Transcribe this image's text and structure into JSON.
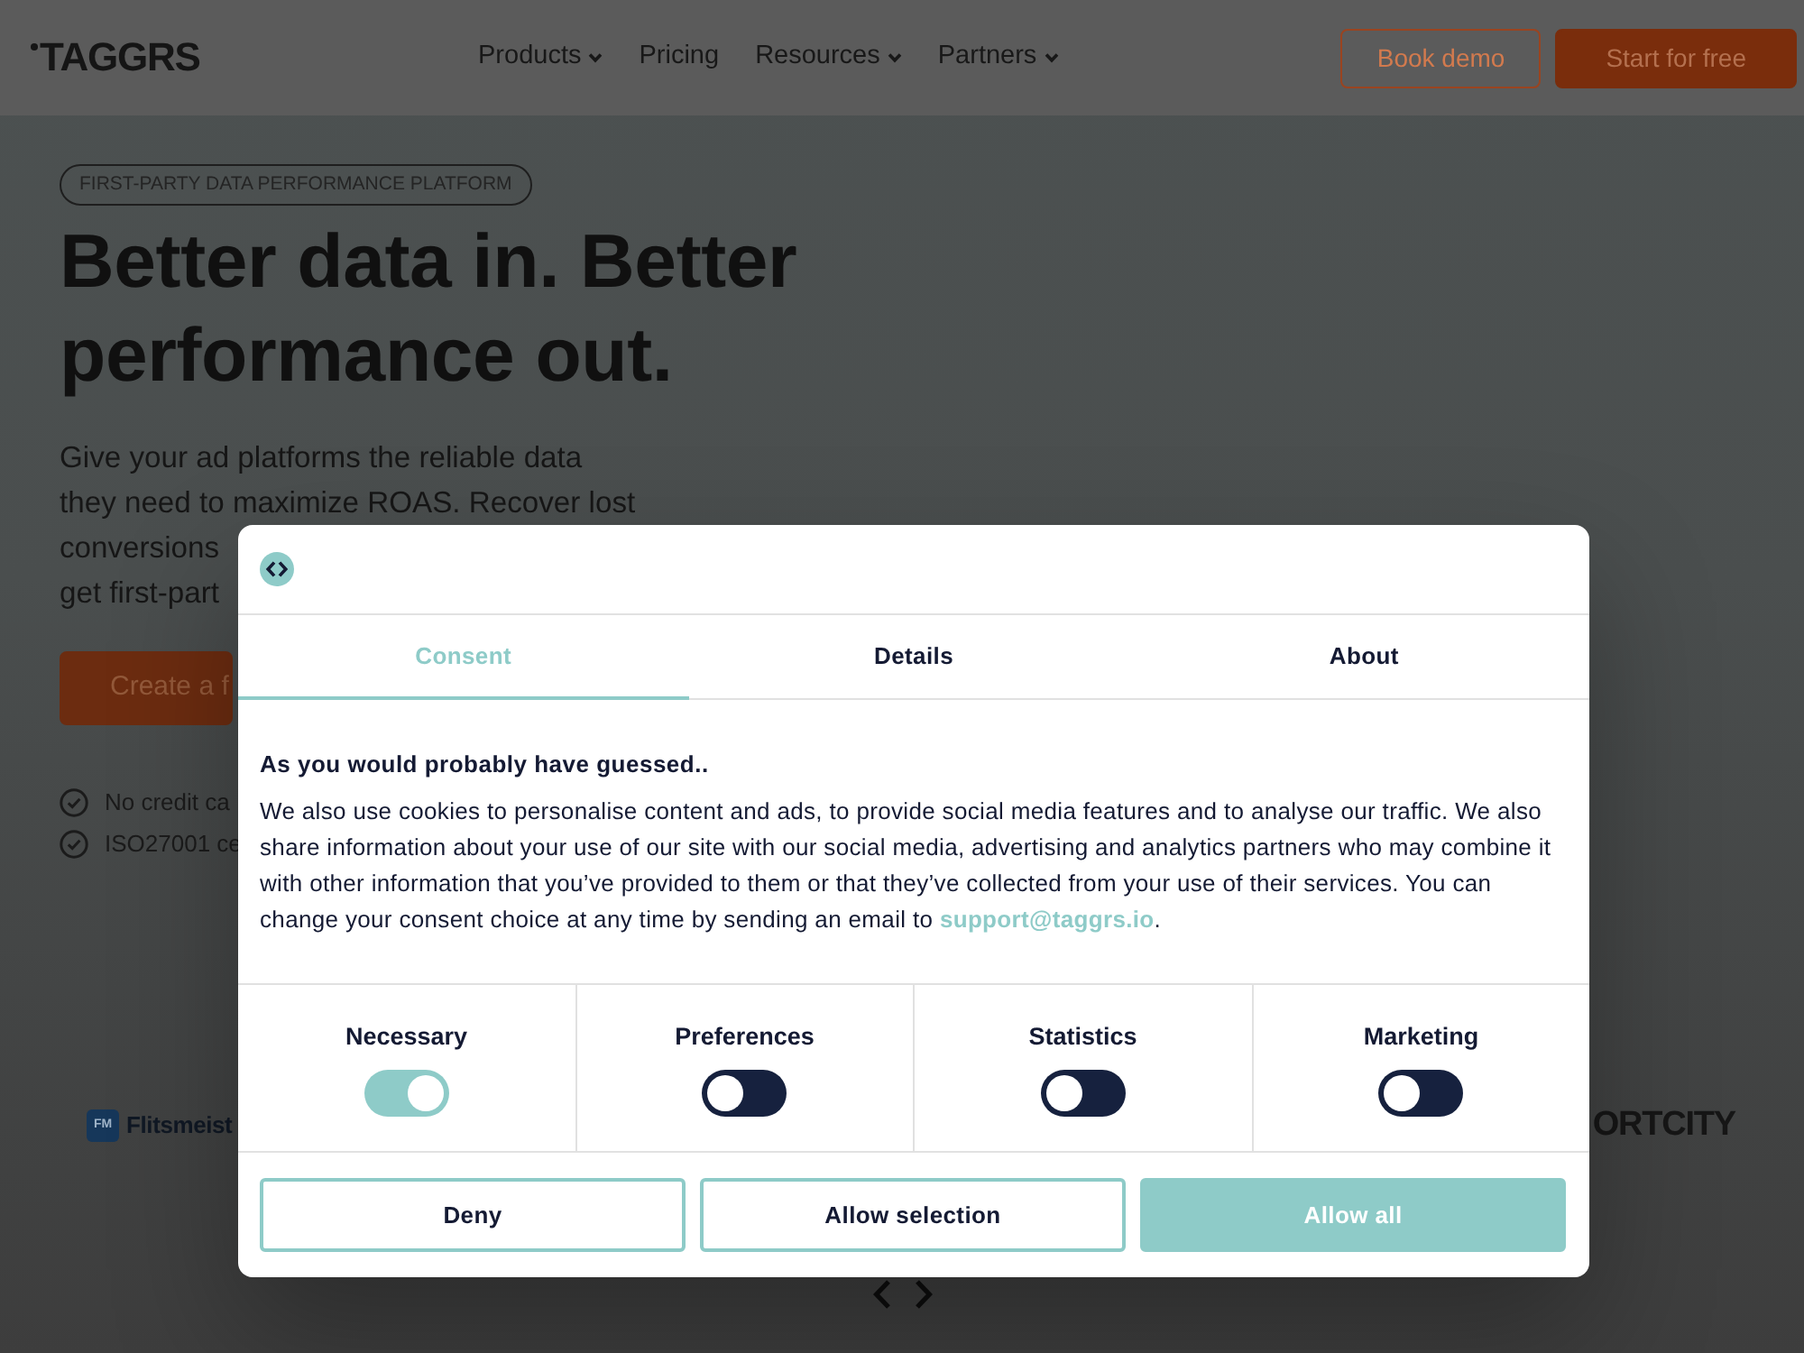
{
  "header": {
    "logo": "TAGGRS",
    "nav": [
      {
        "label": "Products",
        "dropdown": true
      },
      {
        "label": "Pricing",
        "dropdown": false
      },
      {
        "label": "Resources",
        "dropdown": true
      },
      {
        "label": "Partners",
        "dropdown": true
      }
    ],
    "buttons": [
      {
        "label": "Book demo",
        "kind": "outline"
      },
      {
        "label": "Start for free",
        "kind": "solid"
      }
    ]
  },
  "hero": {
    "badge": "FIRST-PARTY DATA PERFORMANCE PLATFORM",
    "title": "Better data in. Better performance out.",
    "text_lines": [
      "Give your ad platforms the reliable data",
      "they need to maximize ROAS. Recover lost",
      "conversions",
      "get first-part"
    ],
    "cta": "Create a f",
    "checks": [
      "No credit ca",
      "ISO27001 ce"
    ]
  },
  "logos": [
    {
      "kind": "tile",
      "mark": "FM",
      "name": "Flitsmeist"
    },
    {
      "kind": "wordmark",
      "name": "ORTCITY"
    }
  ],
  "consent_dialog": {
    "tabs": [
      {
        "label": "Consent",
        "selected": true
      },
      {
        "label": "Details",
        "selected": false
      },
      {
        "label": "About",
        "selected": false
      }
    ],
    "heading": "As you would probably have guessed..",
    "text": "We also use cookies to personalise content and ads, to provide social media features and to analyse our traffic. We also share information about your use of our site with our social media, advertising and analytics partners who may combine it with other information that you’ve provided to them or that they’ve collected from your use of their services. You can change your consent choice at any time by sending an email to ",
    "link": "support@taggrs.io",
    "text_end": ".",
    "categories": [
      {
        "label": "Necessary",
        "on": true
      },
      {
        "label": "Preferences",
        "on": false
      },
      {
        "label": "Statistics",
        "on": false
      },
      {
        "label": "Marketing",
        "on": false
      }
    ],
    "buttons": [
      {
        "label": "Deny",
        "kind": "outline"
      },
      {
        "label": "Allow selection",
        "kind": "outline"
      },
      {
        "label": "Allow all",
        "kind": "solid"
      }
    ]
  }
}
